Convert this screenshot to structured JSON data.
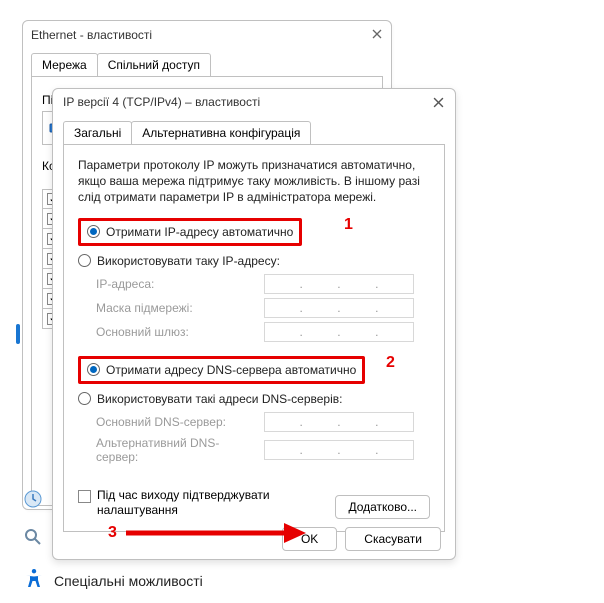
{
  "back_window": {
    "title": "Ethernet - властивості",
    "tabs": [
      "Мережа",
      "Спільний доступ"
    ],
    "section_label_prefix": "Пі",
    "items_label_prefix": "Кс"
  },
  "front_window": {
    "title": "IP версії 4 (TCP/IPv4) – властивості",
    "tabs": [
      "Загальні",
      "Альтернативна конфігурація"
    ],
    "intro": "Параметри протоколу IP можуть призначатися автоматично, якщо ваша мережа підтримує таку можливість. В іншому разі слід отримати параметри IP в адміністратора мережі.",
    "ip_group": {
      "auto": "Отримати IP-адресу автоматично",
      "manual": "Використовувати таку IP-адресу:",
      "fields": {
        "ip": "IP-адреса:",
        "mask": "Маска підмережі:",
        "gateway": "Основний шлюз:"
      }
    },
    "dns_group": {
      "auto": "Отримати адресу DNS-сервера автоматично",
      "manual": "Використовувати такі адреси DNS-серверів:",
      "fields": {
        "primary": "Основний DNS-сервер:",
        "alt": "Альтернативний DNS-сервер:"
      }
    },
    "validate_checkbox": "Під час виходу підтверджувати налаштування",
    "advanced_btn": "Додатково...",
    "ok_btn": "OK",
    "cancel_btn": "Скасувати"
  },
  "annotations": {
    "n1": "1",
    "n2": "2",
    "n3": "3"
  },
  "a11y_label": "Спеціальні можливості"
}
